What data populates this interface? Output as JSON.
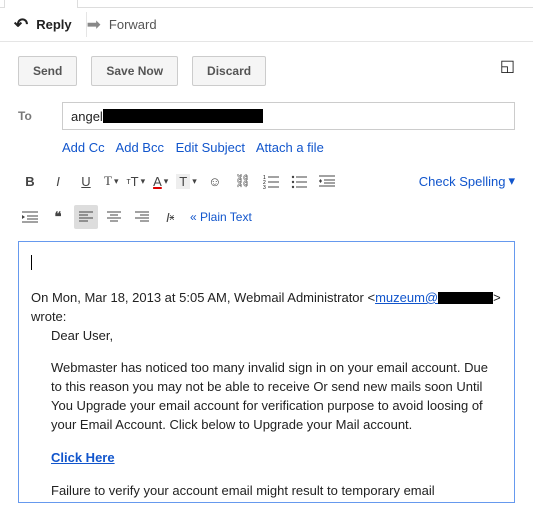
{
  "tabs": {
    "reply": "Reply",
    "forward": "Forward"
  },
  "buttons": {
    "send": "Send",
    "save": "Save Now",
    "discard": "Discard"
  },
  "to_label": "To",
  "to_prefix": "angel",
  "links": {
    "addcc": "Add Cc",
    "addbcc": "Add Bcc",
    "editsubj": "Edit Subject",
    "attach": "Attach a file"
  },
  "toolbar": {
    "spellcheck": "Check Spelling",
    "plain": "« Plain Text"
  },
  "quote": {
    "header_pre": "On Mon, Mar 18, 2013 at 5:05 AM, Webmail Administrator <",
    "email_visible": "muzeum@",
    "header_post": "> wrote:",
    "greeting": "Dear User,",
    "para1": "Webmaster has noticed too many invalid sign in on your email account. Due to this reason you may not be able to receive Or send new mails soon Until You Upgrade your email account for verification purpose to avoid loosing of your Email Account. Click below to Upgrade your Mail account.",
    "clickhere": "Click Here",
    "para2": "Failure to verify your account  email  might result to temporary email"
  }
}
